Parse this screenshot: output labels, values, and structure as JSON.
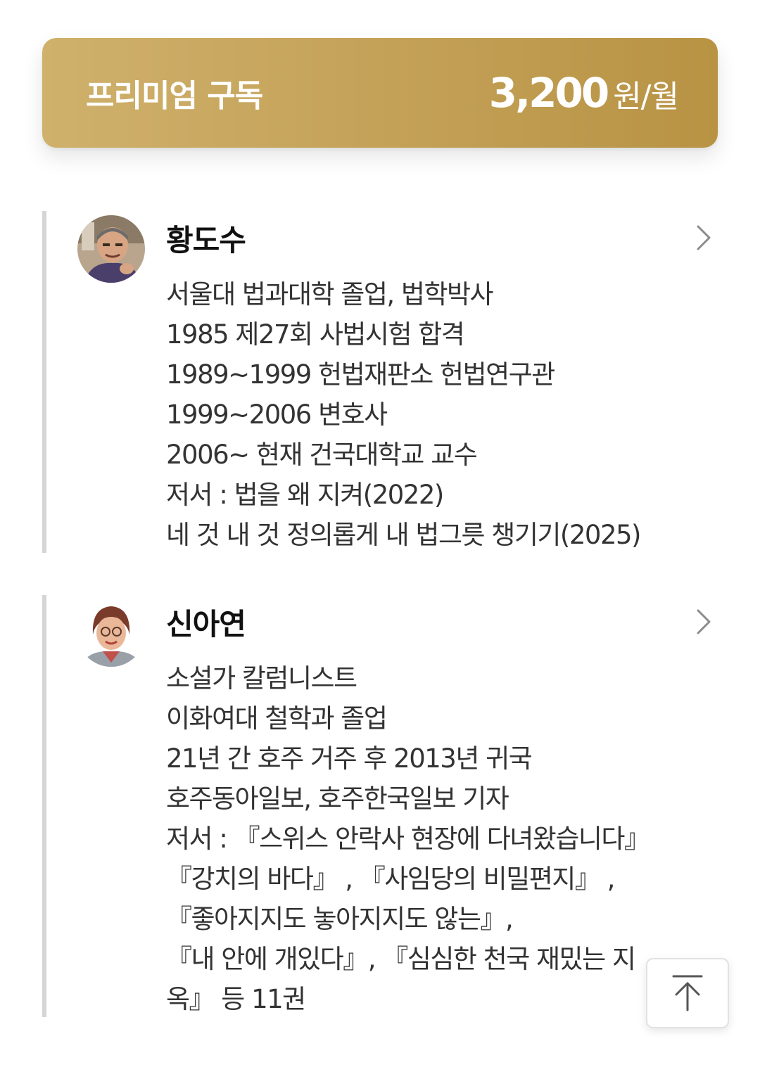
{
  "subscription": {
    "title": "프리미엄 구독",
    "price": "3,200",
    "unit": "원/월",
    "colors": {
      "gradient_start": "#cfb16c",
      "gradient_end": "#b89344",
      "text": "#ffffff"
    }
  },
  "authors": [
    {
      "name": "황도수",
      "avatar": "author-photo-icon",
      "bio": [
        "서울대 법과대학 졸업, 법학박사",
        "1985 제27회 사법시험 합격",
        "1989~1999 헌법재판소 헌법연구관",
        "1999~2006 변호사",
        "2006~ 현재 건국대학교 교수",
        "저서 : 법을 왜 지켜(2022)",
        "네 것 내 것 정의롭게 내 법그릇 챙기기(2025)"
      ]
    },
    {
      "name": "신아연",
      "avatar": "author-photo-icon",
      "bio": [
        "소설가 칼럼니스트",
        "이화여대 철학과 졸업",
        "21년 간 호주 거주 후 2013년 귀국",
        "호주동아일보, 호주한국일보 기자",
        "저서 : 『스위스 안락사 현장에 다녀왔습니다』",
        "『강치의 바다』 , 『사임당의 비밀편지』 ,",
        "『좋아지지도 놓아지지도 않는』,",
        "『내 안에 개있다』, 『심심한 천국 재밌는 지",
        "옥』 등 11권"
      ]
    }
  ],
  "icons": {
    "chevron": "chevron-right-icon",
    "scroll_top": "arrow-up-icon"
  },
  "colors": {
    "card_border": "#d5d5d5",
    "bio_text": "#333333",
    "name_text": "#111111"
  }
}
